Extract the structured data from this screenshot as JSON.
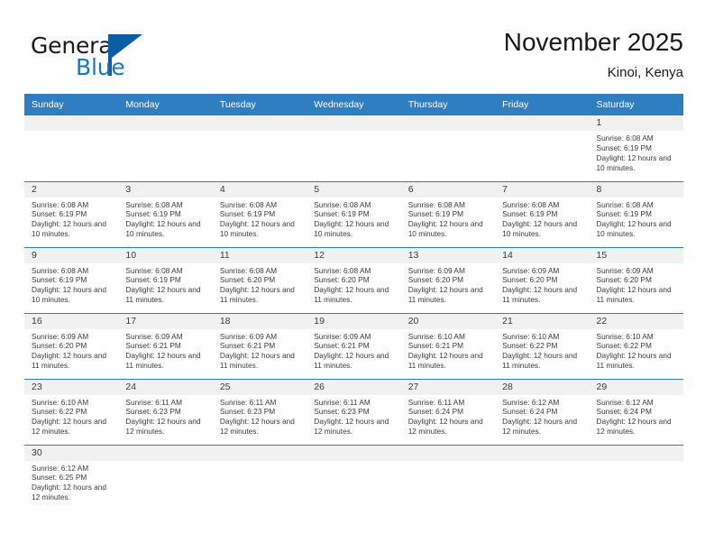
{
  "branding": {
    "logo_primary": "General",
    "logo_secondary": "Blue"
  },
  "header": {
    "title": "November 2025",
    "location": "Kinoi, Kenya"
  },
  "colors": {
    "header_blue": "#2f7ec1",
    "logo_blue_dark": "#0d5ca6",
    "logo_blue_light": "#1878c4",
    "day_strip_gray": "#f1f1f1",
    "text": "#3b3b3b"
  },
  "calendar": {
    "weekdays": [
      "Sunday",
      "Monday",
      "Tuesday",
      "Wednesday",
      "Thursday",
      "Friday",
      "Saturday"
    ],
    "labels": {
      "sunrise": "Sunrise:",
      "sunset": "Sunset:",
      "daylight": "Daylight:"
    },
    "weeks": [
      [
        null,
        null,
        null,
        null,
        null,
        null,
        {
          "day": "1",
          "sunrise": "Sunrise: 6:08 AM",
          "sunset": "Sunset: 6:19 PM",
          "daylight": "Daylight: 12 hours and 10 minutes."
        }
      ],
      [
        {
          "day": "2",
          "sunrise": "Sunrise: 6:08 AM",
          "sunset": "Sunset: 6:19 PM",
          "daylight": "Daylight: 12 hours and 10 minutes."
        },
        {
          "day": "3",
          "sunrise": "Sunrise: 6:08 AM",
          "sunset": "Sunset: 6:19 PM",
          "daylight": "Daylight: 12 hours and 10 minutes."
        },
        {
          "day": "4",
          "sunrise": "Sunrise: 6:08 AM",
          "sunset": "Sunset: 6:19 PM",
          "daylight": "Daylight: 12 hours and 10 minutes."
        },
        {
          "day": "5",
          "sunrise": "Sunrise: 6:08 AM",
          "sunset": "Sunset: 6:19 PM",
          "daylight": "Daylight: 12 hours and 10 minutes."
        },
        {
          "day": "6",
          "sunrise": "Sunrise: 6:08 AM",
          "sunset": "Sunset: 6:19 PM",
          "daylight": "Daylight: 12 hours and 10 minutes."
        },
        {
          "day": "7",
          "sunrise": "Sunrise: 6:08 AM",
          "sunset": "Sunset: 6:19 PM",
          "daylight": "Daylight: 12 hours and 10 minutes."
        },
        {
          "day": "8",
          "sunrise": "Sunrise: 6:08 AM",
          "sunset": "Sunset: 6:19 PM",
          "daylight": "Daylight: 12 hours and 10 minutes."
        }
      ],
      [
        {
          "day": "9",
          "sunrise": "Sunrise: 6:08 AM",
          "sunset": "Sunset: 6:19 PM",
          "daylight": "Daylight: 12 hours and 10 minutes."
        },
        {
          "day": "10",
          "sunrise": "Sunrise: 6:08 AM",
          "sunset": "Sunset: 6:19 PM",
          "daylight": "Daylight: 12 hours and 11 minutes."
        },
        {
          "day": "11",
          "sunrise": "Sunrise: 6:08 AM",
          "sunset": "Sunset: 6:20 PM",
          "daylight": "Daylight: 12 hours and 11 minutes."
        },
        {
          "day": "12",
          "sunrise": "Sunrise: 6:08 AM",
          "sunset": "Sunset: 6:20 PM",
          "daylight": "Daylight: 12 hours and 11 minutes."
        },
        {
          "day": "13",
          "sunrise": "Sunrise: 6:09 AM",
          "sunset": "Sunset: 6:20 PM",
          "daylight": "Daylight: 12 hours and 11 minutes."
        },
        {
          "day": "14",
          "sunrise": "Sunrise: 6:09 AM",
          "sunset": "Sunset: 6:20 PM",
          "daylight": "Daylight: 12 hours and 11 minutes."
        },
        {
          "day": "15",
          "sunrise": "Sunrise: 6:09 AM",
          "sunset": "Sunset: 6:20 PM",
          "daylight": "Daylight: 12 hours and 11 minutes."
        }
      ],
      [
        {
          "day": "16",
          "sunrise": "Sunrise: 6:09 AM",
          "sunset": "Sunset: 6:20 PM",
          "daylight": "Daylight: 12 hours and 11 minutes."
        },
        {
          "day": "17",
          "sunrise": "Sunrise: 6:09 AM",
          "sunset": "Sunset: 6:21 PM",
          "daylight": "Daylight: 12 hours and 11 minutes."
        },
        {
          "day": "18",
          "sunrise": "Sunrise: 6:09 AM",
          "sunset": "Sunset: 6:21 PM",
          "daylight": "Daylight: 12 hours and 11 minutes."
        },
        {
          "day": "19",
          "sunrise": "Sunrise: 6:09 AM",
          "sunset": "Sunset: 6:21 PM",
          "daylight": "Daylight: 12 hours and 11 minutes."
        },
        {
          "day": "20",
          "sunrise": "Sunrise: 6:10 AM",
          "sunset": "Sunset: 6:21 PM",
          "daylight": "Daylight: 12 hours and 11 minutes."
        },
        {
          "day": "21",
          "sunrise": "Sunrise: 6:10 AM",
          "sunset": "Sunset: 6:22 PM",
          "daylight": "Daylight: 12 hours and 11 minutes."
        },
        {
          "day": "22",
          "sunrise": "Sunrise: 6:10 AM",
          "sunset": "Sunset: 6:22 PM",
          "daylight": "Daylight: 12 hours and 11 minutes."
        }
      ],
      [
        {
          "day": "23",
          "sunrise": "Sunrise: 6:10 AM",
          "sunset": "Sunset: 6:22 PM",
          "daylight": "Daylight: 12 hours and 12 minutes."
        },
        {
          "day": "24",
          "sunrise": "Sunrise: 6:11 AM",
          "sunset": "Sunset: 6:23 PM",
          "daylight": "Daylight: 12 hours and 12 minutes."
        },
        {
          "day": "25",
          "sunrise": "Sunrise: 6:11 AM",
          "sunset": "Sunset: 6:23 PM",
          "daylight": "Daylight: 12 hours and 12 minutes."
        },
        {
          "day": "26",
          "sunrise": "Sunrise: 6:11 AM",
          "sunset": "Sunset: 6:23 PM",
          "daylight": "Daylight: 12 hours and 12 minutes."
        },
        {
          "day": "27",
          "sunrise": "Sunrise: 6:11 AM",
          "sunset": "Sunset: 6:24 PM",
          "daylight": "Daylight: 12 hours and 12 minutes."
        },
        {
          "day": "28",
          "sunrise": "Sunrise: 6:12 AM",
          "sunset": "Sunset: 6:24 PM",
          "daylight": "Daylight: 12 hours and 12 minutes."
        },
        {
          "day": "29",
          "sunrise": "Sunrise: 6:12 AM",
          "sunset": "Sunset: 6:24 PM",
          "daylight": "Daylight: 12 hours and 12 minutes."
        }
      ],
      [
        {
          "day": "30",
          "sunrise": "Sunrise: 6:12 AM",
          "sunset": "Sunset: 6:25 PM",
          "daylight": "Daylight: 12 hours and 12 minutes."
        },
        null,
        null,
        null,
        null,
        null,
        null
      ]
    ]
  }
}
